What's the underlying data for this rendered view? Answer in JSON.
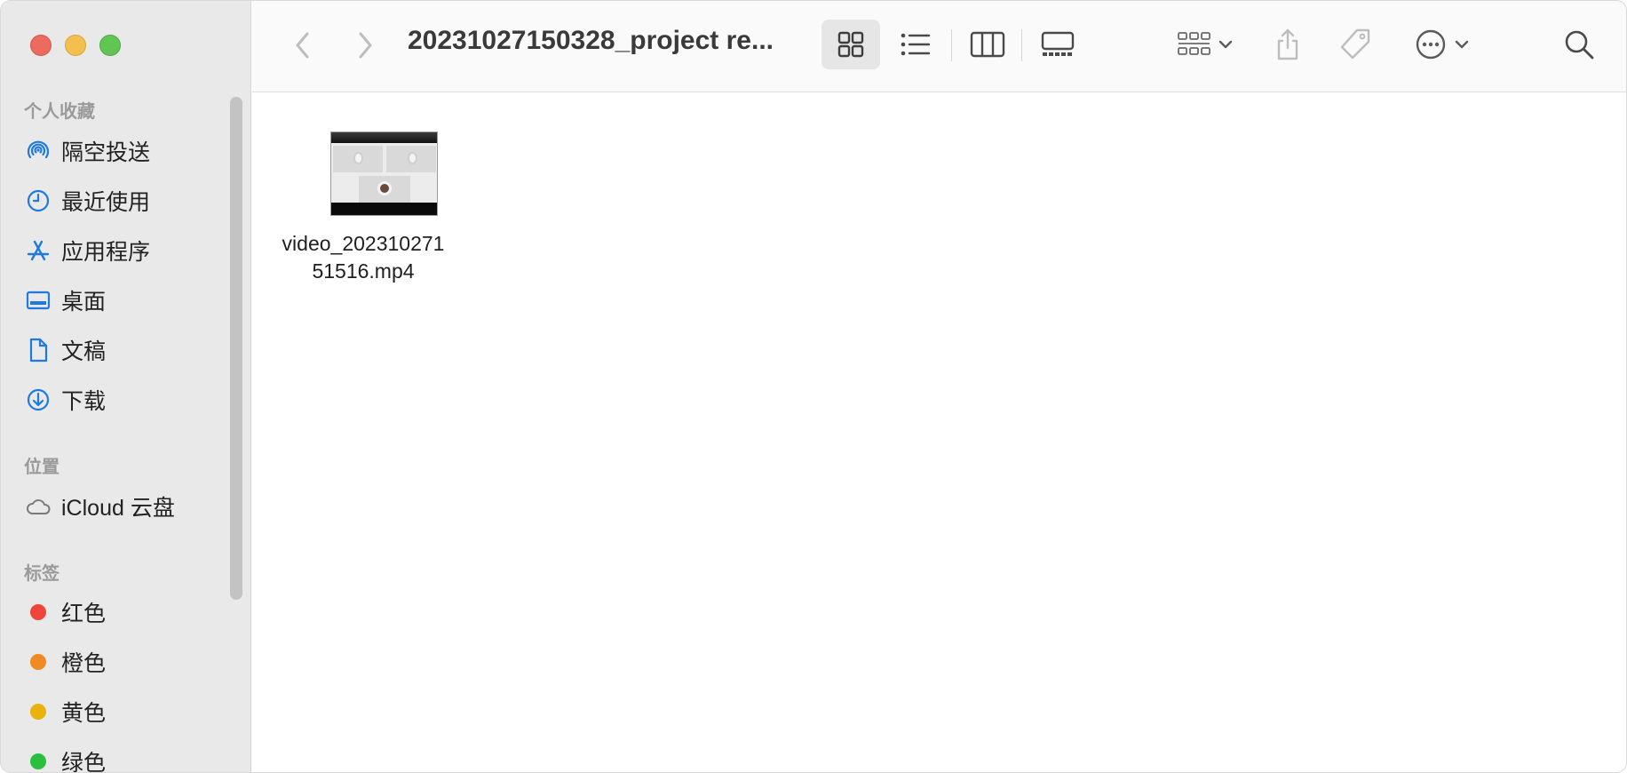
{
  "window": {
    "title": "20231027150328_project re..."
  },
  "sidebar": {
    "favorites_heading": "个人收藏",
    "favorites": [
      {
        "label": "隔空投送",
        "icon": "airdrop-icon"
      },
      {
        "label": "最近使用",
        "icon": "clock-icon"
      },
      {
        "label": "应用程序",
        "icon": "app-store-icon"
      },
      {
        "label": "桌面",
        "icon": "desktop-icon"
      },
      {
        "label": "文稿",
        "icon": "document-icon"
      },
      {
        "label": "下载",
        "icon": "download-icon"
      }
    ],
    "locations_heading": "位置",
    "locations": [
      {
        "label": "iCloud 云盘",
        "icon": "cloud-icon"
      }
    ],
    "tags_heading": "标签",
    "tags": [
      {
        "label": "红色",
        "color": "#f0453a"
      },
      {
        "label": "橙色",
        "color": "#f08a24"
      },
      {
        "label": "黄色",
        "color": "#e9b20d"
      },
      {
        "label": "绿色",
        "color": "#2bbf3f"
      }
    ]
  },
  "toolbar": {
    "icons": [
      "back-icon",
      "forward-icon",
      "icon-view-icon",
      "list-view-icon",
      "column-view-icon",
      "gallery-view-icon",
      "group-icon",
      "share-icon",
      "tag-icon",
      "more-icon",
      "search-icon"
    ],
    "accent_color": "#1f7ae0"
  },
  "files": [
    {
      "name_line1": "video_202310271",
      "name_line2": "51516.mp4"
    }
  ]
}
